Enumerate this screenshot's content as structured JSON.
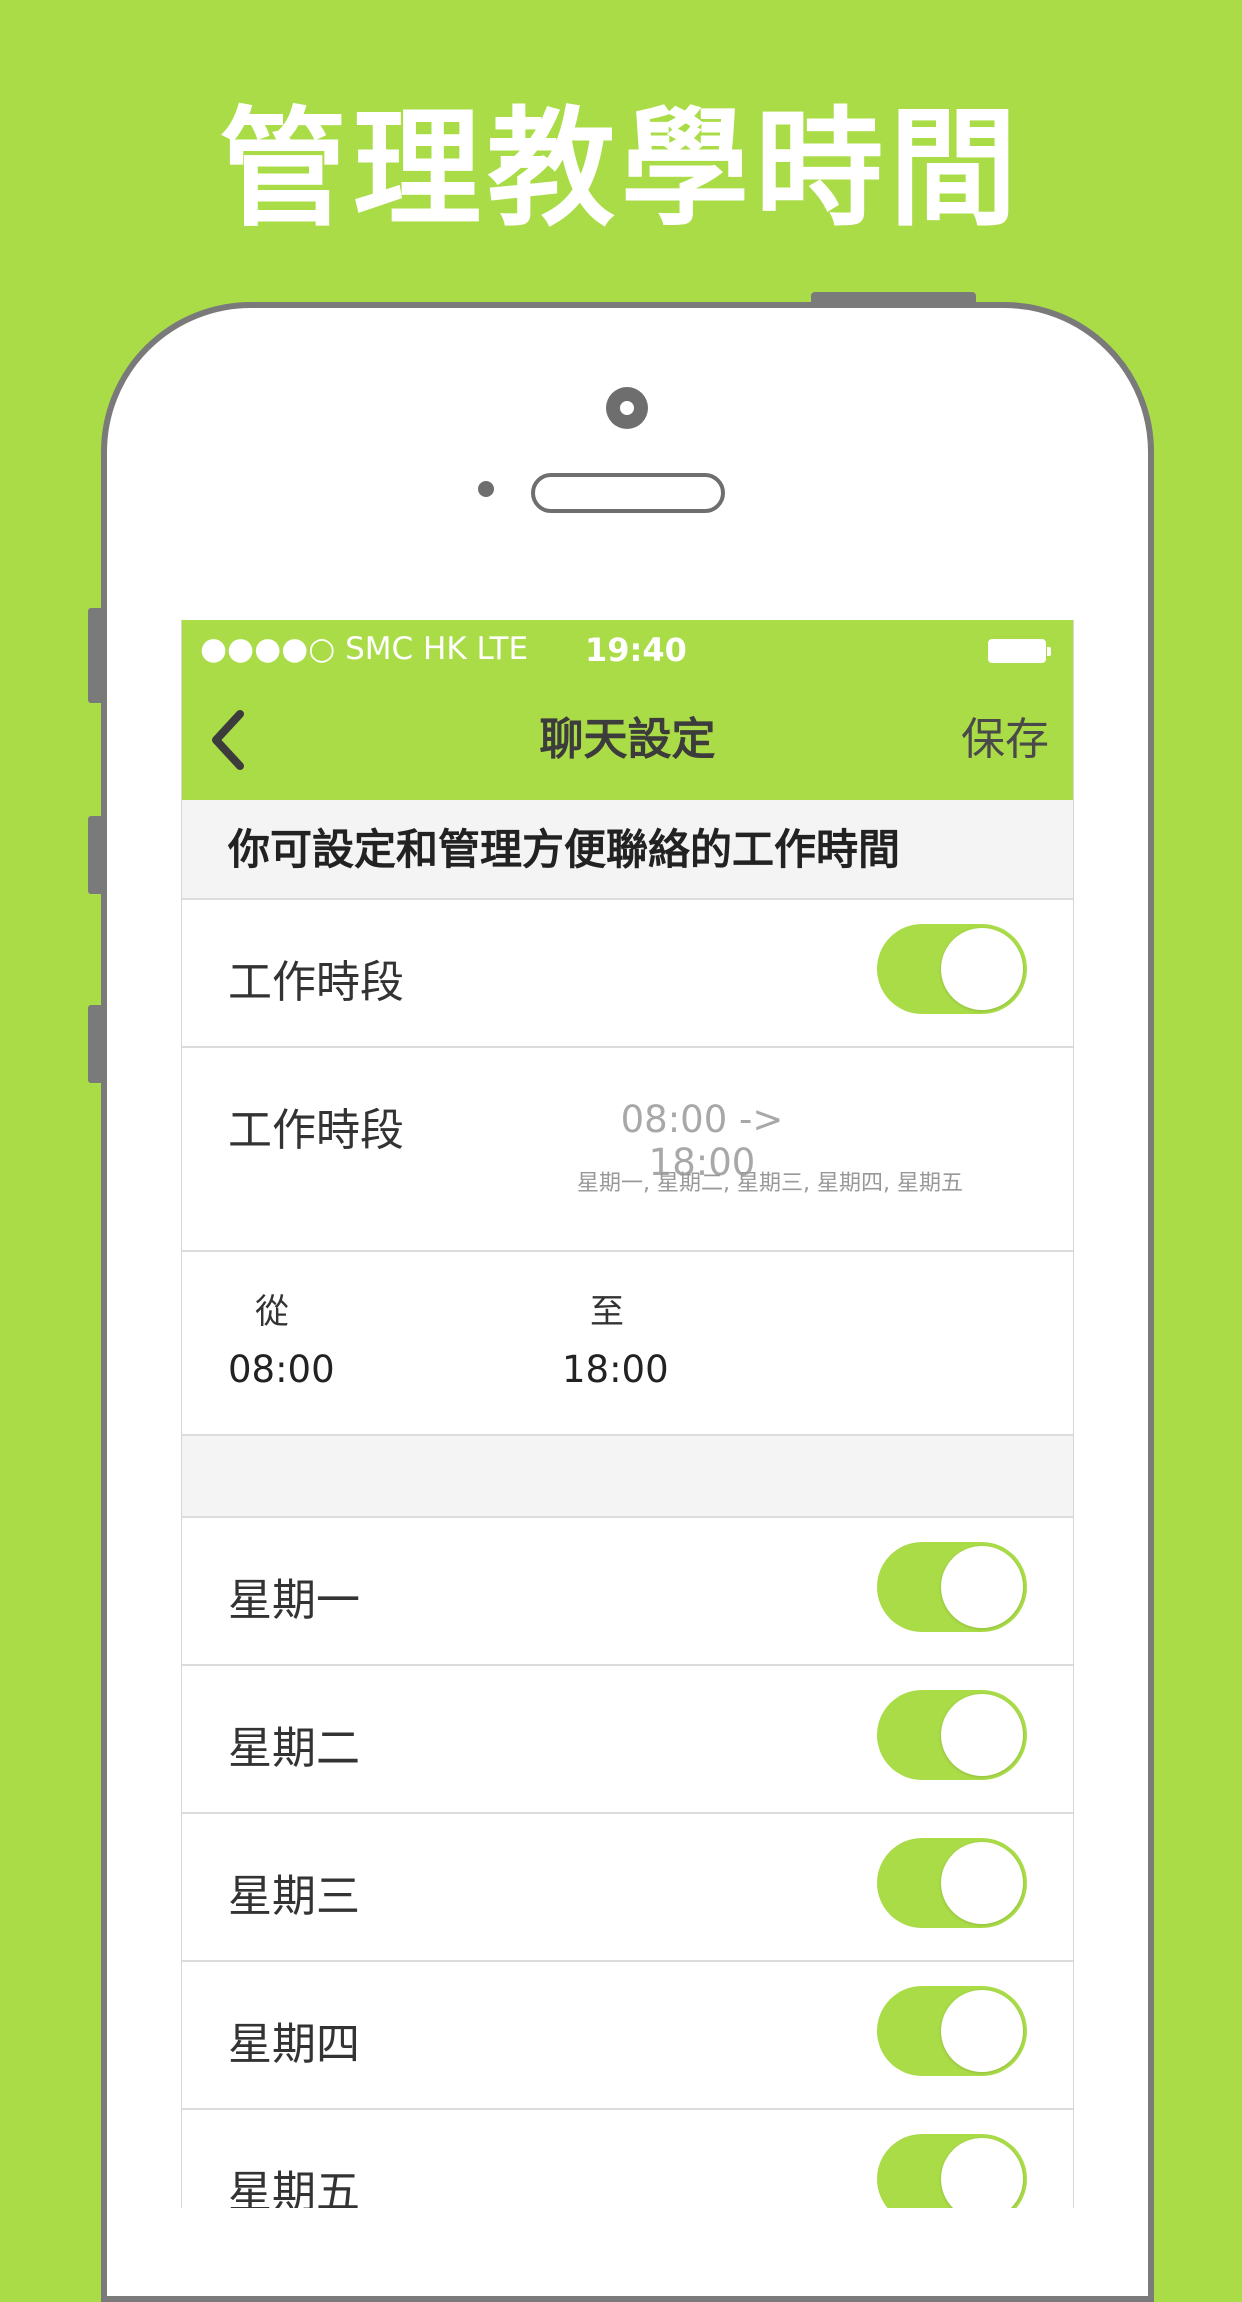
{
  "headline": "管理教學時間",
  "status_bar": {
    "carrier": "●●●●○ SMC HK   LTE",
    "time": "19:40"
  },
  "nav": {
    "title": "聊天設定",
    "save_label": "保存"
  },
  "info_text": "你可設定和管理方便聯絡的工作時間",
  "work_period_toggle": {
    "label": "工作時段",
    "on": true
  },
  "work_period_summary": {
    "label": "工作時段",
    "range": "08:00 -> 18:00",
    "days": "星期一, 星期二, 星期三, 星期四, 星期五"
  },
  "time_range": {
    "from_label": "從",
    "from_value": "08:00",
    "to_label": "至",
    "to_value": "18:00"
  },
  "days": [
    {
      "label": "星期一",
      "on": true
    },
    {
      "label": "星期二",
      "on": true
    },
    {
      "label": "星期三",
      "on": true
    },
    {
      "label": "星期四",
      "on": true
    },
    {
      "label": "星期五",
      "on": true
    }
  ],
  "colors": {
    "accent": "#aadc48",
    "frame": "#7a7a7a"
  },
  "icons": {
    "back": "chevron-left-icon"
  }
}
